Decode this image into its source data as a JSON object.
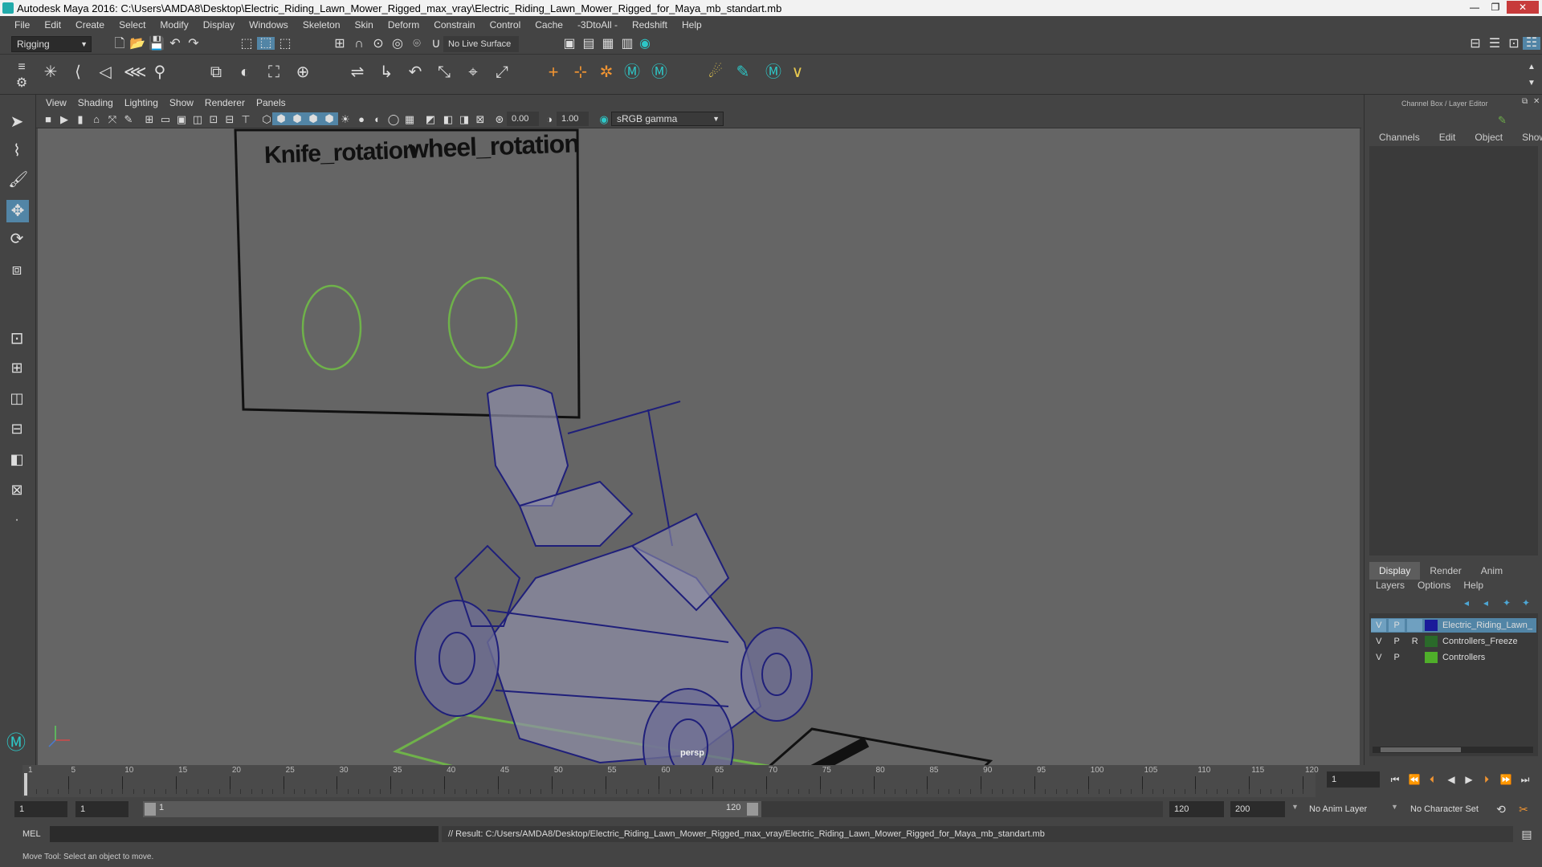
{
  "window": {
    "title": "Autodesk Maya 2016: C:\\Users\\AMDA8\\Desktop\\Electric_Riding_Lawn_Mower_Rigged_max_vray\\Electric_Riding_Lawn_Mower_Rigged_for_Maya_mb_standart.mb",
    "minimize": "—",
    "maximize": "❐",
    "close": "✕"
  },
  "menubar": [
    "File",
    "Edit",
    "Create",
    "Select",
    "Modify",
    "Display",
    "Windows",
    "Skeleton",
    "Skin",
    "Deform",
    "Constrain",
    "Control",
    "Cache",
    "-3DtoAll -",
    "Redshift",
    "Help"
  ],
  "statusline": {
    "mode": "Rigging",
    "live_surface": "No Live Surface"
  },
  "panel": {
    "menus": [
      "View",
      "Shading",
      "Lighting",
      "Show",
      "Renderer",
      "Panels"
    ],
    "exposure": "0.00",
    "gamma": "1.00",
    "colorspace": "sRGB gamma",
    "camera_label": "persp"
  },
  "viewport": {
    "controller_labels": [
      "Knife_rotation",
      "wheel_rotation"
    ],
    "colors": {
      "background": "#656565",
      "wire": "#1f1f7a",
      "controller": "#6fb24a"
    }
  },
  "channelbox": {
    "title": "Channel Box / Layer Editor",
    "menus": [
      "Channels",
      "Edit",
      "Object",
      "Show"
    ],
    "layer_tabs": [
      "Display",
      "Render",
      "Anim"
    ],
    "active_tab": "Display",
    "layer_menus": [
      "Layers",
      "Options",
      "Help"
    ],
    "layers": [
      {
        "v": "V",
        "p": "P",
        "r": "",
        "name": "Electric_Riding_Lawn_",
        "color": "#1a1a9a",
        "selected": true
      },
      {
        "v": "V",
        "p": "P",
        "r": "R",
        "name": "Controllers_Freeze",
        "color": "#2a6a2a",
        "selected": false
      },
      {
        "v": "V",
        "p": "P",
        "r": "",
        "name": "Controllers",
        "color": "#4fae2a",
        "selected": false
      }
    ]
  },
  "timeline": {
    "tick_labels": [
      "1",
      "5",
      "10",
      "15",
      "20",
      "25",
      "30",
      "35",
      "40",
      "45",
      "50",
      "55",
      "60",
      "65",
      "70",
      "75",
      "80",
      "85",
      "90",
      "95",
      "100",
      "105",
      "110",
      "115",
      "120"
    ],
    "current_frame": "1"
  },
  "range": {
    "start": "1",
    "playback_start": "1",
    "slider_start": "1",
    "slider_end": "120",
    "playback_end": "120",
    "end": "200",
    "anim_layer": "No Anim Layer",
    "character_set": "No Character Set"
  },
  "commandline": {
    "language": "MEL",
    "result": "// Result: C:/Users/AMDA8/Desktop/Electric_Riding_Lawn_Mower_Rigged_max_vray/Electric_Riding_Lawn_Mower_Rigged_for_Maya_mb_standart.mb"
  },
  "helpline": {
    "text": "Move Tool: Select an object to move."
  }
}
